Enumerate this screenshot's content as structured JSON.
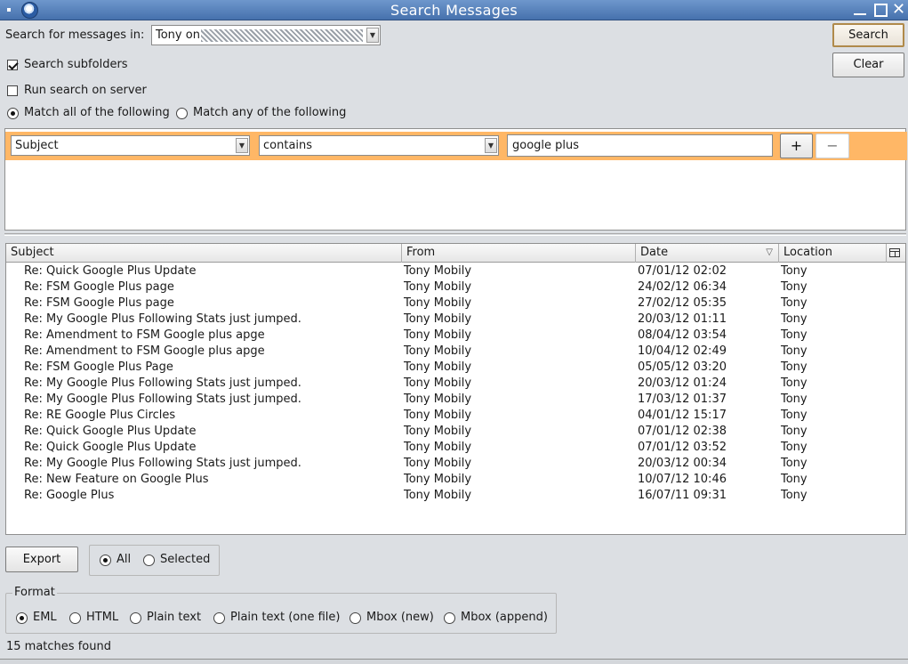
{
  "window": {
    "title": "Search Messages"
  },
  "search_bar": {
    "folder_label": "Search for messages in:",
    "folder_value": "Tony on",
    "search_button": "Search",
    "clear_button": "Clear"
  },
  "options": {
    "search_subfolders": {
      "label": "Search subfolders",
      "checked": true
    },
    "run_on_server": {
      "label": "Run search on server",
      "checked": false
    },
    "match_all": {
      "label": "Match all of the following",
      "selected": true
    },
    "match_any": {
      "label": "Match any of the following",
      "selected": false
    }
  },
  "criteria": {
    "field": "Subject",
    "operator": "contains",
    "value": "google plus",
    "add_label": "+",
    "remove_label": "−"
  },
  "table": {
    "columns": [
      "Subject",
      "From",
      "Date",
      "Location"
    ],
    "sort_indicator": "▽",
    "rows": [
      {
        "subject": "Re: Quick Google Plus Update",
        "from": "Tony Mobily",
        "date": "07/01/12 02:02",
        "location": "Tony"
      },
      {
        "subject": "Re: FSM Google Plus page",
        "from": "Tony Mobily",
        "date": "24/02/12 06:34",
        "location": "Tony"
      },
      {
        "subject": "Re: FSM Google Plus page",
        "from": "Tony Mobily",
        "date": "27/02/12 05:35",
        "location": "Tony"
      },
      {
        "subject": "Re: My Google Plus Following Stats just jumped.",
        "from": "Tony Mobily",
        "date": "20/03/12 01:11",
        "location": "Tony"
      },
      {
        "subject": "Re: Amendment to FSM Google plus apge",
        "from": "Tony Mobily",
        "date": "08/04/12 03:54",
        "location": "Tony"
      },
      {
        "subject": "Re: Amendment to FSM Google plus apge",
        "from": "Tony Mobily",
        "date": "10/04/12 02:49",
        "location": "Tony"
      },
      {
        "subject": "Re: FSM Google Plus Page",
        "from": "Tony Mobily",
        "date": "05/05/12 03:20",
        "location": "Tony"
      },
      {
        "subject": "Re: My Google Plus Following Stats just jumped.",
        "from": "Tony Mobily",
        "date": "20/03/12 01:24",
        "location": "Tony"
      },
      {
        "subject": "Re: My Google Plus Following Stats just jumped.",
        "from": "Tony Mobily",
        "date": "17/03/12 01:37",
        "location": "Tony"
      },
      {
        "subject": "Re: RE Google Plus Circles",
        "from": "Tony Mobily",
        "date": "04/01/12 15:17",
        "location": "Tony"
      },
      {
        "subject": "Re: Quick Google Plus Update",
        "from": "Tony Mobily",
        "date": "07/01/12 02:38",
        "location": "Tony"
      },
      {
        "subject": "Re: Quick Google Plus Update",
        "from": "Tony Mobily",
        "date": "07/01/12 03:52",
        "location": "Tony"
      },
      {
        "subject": "Re: My Google Plus Following Stats just jumped.",
        "from": "Tony Mobily",
        "date": "20/03/12 00:34",
        "location": "Tony"
      },
      {
        "subject": "Re: New Feature on Google Plus",
        "from": "Tony Mobily",
        "date": "10/07/12 10:46",
        "location": "Tony"
      },
      {
        "subject": "Re: Google Plus",
        "from": "Tony Mobily",
        "date": "16/07/11 09:31",
        "location": "Tony"
      }
    ]
  },
  "export": {
    "button": "Export",
    "scope_all": {
      "label": "All",
      "selected": true
    },
    "scope_selected": {
      "label": "Selected",
      "selected": false
    }
  },
  "format": {
    "legend": "Format",
    "options": [
      {
        "label": "EML",
        "selected": true
      },
      {
        "label": "HTML",
        "selected": false
      },
      {
        "label": "Plain text",
        "selected": false
      },
      {
        "label": "Plain text (one file)",
        "selected": false
      },
      {
        "label": "Mbox (new)",
        "selected": false
      },
      {
        "label": "Mbox (append)",
        "selected": false
      }
    ]
  },
  "status": {
    "text": "15 matches found"
  },
  "colors": {
    "titlebar": "#4f7ab6",
    "criteria_highlight": "#ffb766",
    "default_button_border": "#b08a4a"
  }
}
